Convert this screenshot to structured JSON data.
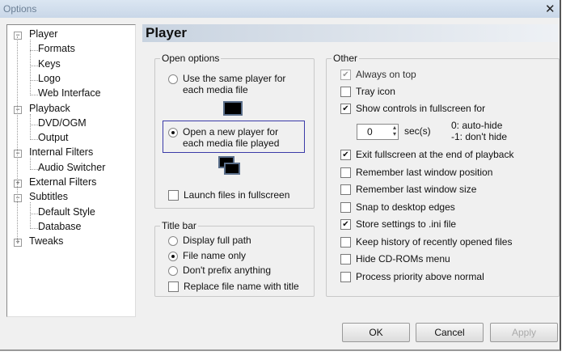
{
  "window": {
    "title": "Options",
    "close_icon": "close-icon"
  },
  "tree": [
    {
      "label": "Player",
      "level": 0,
      "expanded": true
    },
    {
      "label": "Formats",
      "level": 1
    },
    {
      "label": "Keys",
      "level": 1
    },
    {
      "label": "Logo",
      "level": 1
    },
    {
      "label": "Web Interface",
      "level": 1
    },
    {
      "label": "Playback",
      "level": 0,
      "expanded": true
    },
    {
      "label": "DVD/OGM",
      "level": 1
    },
    {
      "label": "Output",
      "level": 1
    },
    {
      "label": "Internal Filters",
      "level": 0,
      "expanded": true
    },
    {
      "label": "Audio Switcher",
      "level": 1
    },
    {
      "label": "External Filters",
      "level": 0
    },
    {
      "label": "Subtitles",
      "level": 0,
      "expanded": true
    },
    {
      "label": "Default Style",
      "level": 1
    },
    {
      "label": "Database",
      "level": 1
    },
    {
      "label": "Tweaks",
      "level": 0
    }
  ],
  "page": {
    "title": "Player"
  },
  "open_options": {
    "legend": "Open options",
    "same_player": {
      "line1": "Use the same player for",
      "line2": "each media file",
      "checked": false
    },
    "new_player": {
      "line1": "Open a new player for",
      "line2": "each media file played",
      "checked": true
    },
    "launch_fullscreen": {
      "label": "Launch files in fullscreen",
      "checked": false
    }
  },
  "title_bar": {
    "legend": "Title bar",
    "options": [
      {
        "label": "Display full path",
        "checked": false
      },
      {
        "label": "File name only",
        "checked": true
      },
      {
        "label": "Don't prefix anything",
        "checked": false
      }
    ],
    "replace": {
      "label": "Replace file name with title",
      "checked": false
    }
  },
  "other": {
    "legend": "Other",
    "items_top": [
      {
        "label": "Always on top",
        "checked": true,
        "disabled": true
      },
      {
        "label": "Tray icon",
        "checked": false
      },
      {
        "label": "Show controls in fullscreen for",
        "checked": true
      }
    ],
    "spinner": {
      "value": "0",
      "unit": "sec(s)",
      "hint1": "0: auto-hide",
      "hint2": "-1: don't hide"
    },
    "items_bottom": [
      {
        "label": "Exit fullscreen at the end of playback",
        "checked": true
      },
      {
        "label": "Remember last window position",
        "checked": false
      },
      {
        "label": "Remember last window size",
        "checked": false
      },
      {
        "label": "Snap to desktop edges",
        "checked": false
      },
      {
        "label": "Store settings to .ini file",
        "checked": true
      },
      {
        "label": "Keep history of recently opened files",
        "checked": false
      },
      {
        "label": "Hide CD-ROMs menu",
        "checked": false
      },
      {
        "label": "Process priority above normal",
        "checked": false
      }
    ]
  },
  "buttons": {
    "ok": "OK",
    "cancel": "Cancel",
    "apply": "Apply"
  }
}
